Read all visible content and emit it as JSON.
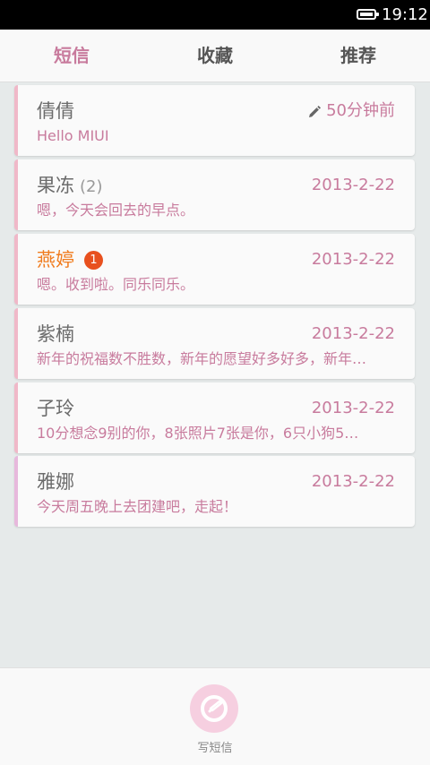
{
  "status_bar": {
    "time": "19:12"
  },
  "tabs": [
    {
      "label": "短信",
      "active": true
    },
    {
      "label": "收藏",
      "active": false
    },
    {
      "label": "推荐",
      "active": false
    }
  ],
  "threads": [
    {
      "name": "倩倩",
      "count": "",
      "badge": "",
      "time": "50分钟前",
      "preview": "Hello MIUI",
      "draft_icon": "pencil-icon"
    },
    {
      "name": "果冻",
      "count": "(2)",
      "badge": "",
      "time": "2013-2-22",
      "preview": "嗯，今天会回去的早点。"
    },
    {
      "name": "燕婷",
      "count": "",
      "badge": "1",
      "time": "2013-2-22",
      "preview": "嗯。收到啦。同乐同乐。",
      "unread": true
    },
    {
      "name": "紫楠",
      "count": "",
      "badge": "",
      "time": "2013-2-22",
      "preview": "新年的祝福数不胜数，新年的愿望好多好多，新年…"
    },
    {
      "name": "子玲",
      "count": "",
      "badge": "",
      "time": "2013-2-22",
      "preview": "10分想念9别的你，8张照片7张是你，6只小狗5…"
    },
    {
      "name": "雅娜",
      "count": "",
      "badge": "",
      "time": "2013-2-22",
      "preview": "今天周五晚上去团建吧，走起！"
    }
  ],
  "compose": {
    "label": "写短信",
    "icon": "compose-icon"
  },
  "colors": {
    "accent": "#c87b9d",
    "unread": "#f07c1e",
    "badge": "#e8501e"
  }
}
